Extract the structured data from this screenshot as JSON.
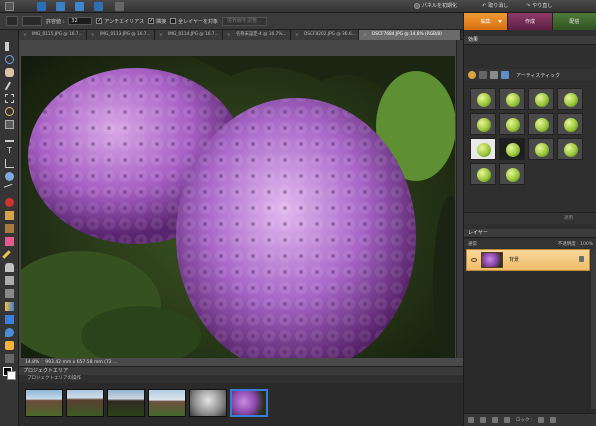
{
  "appbar": {
    "panel_reset": "パネルを初期化",
    "undo": "取り消し",
    "redo": "やり直し"
  },
  "options": {
    "tolerance_label": "許容値 :",
    "tolerance_value": "32",
    "antialias_label": "アンチエイリアス",
    "contiguous_label": "隣接",
    "all_layers_label": "全レイヤーを対象",
    "refine_edge_label": "境界線を調整..."
  },
  "modes": {
    "edit": "編集",
    "create": "作成",
    "share": "配信"
  },
  "doc_tabs": [
    "IMG_0115.JPG @ 16.7...",
    "IMG_0113.JPG @ 16.7...",
    "IMG_0114.JPG @ 16.7...",
    "名称未設定-4 @ 16.7%...",
    "DSCF8202.JPG @ 36.6...",
    "DSCF7684.JPG @ 14.8% (RGB/8)"
  ],
  "status": {
    "zoom": "14.8%",
    "doc_size": "993.42 mm x 657.58 mm (72 ..."
  },
  "project_bin": {
    "title": "プロジェクトエリア",
    "subtitle": "プロジェクトエリアの操作"
  },
  "effects": {
    "title": "効果",
    "category": "アーティスティック",
    "apply": "適用"
  },
  "layers": {
    "title": "レイヤー",
    "mode": "通常",
    "opacity_label": "不透明度 :",
    "opacity_value": "100%",
    "layer_name": "背景",
    "lock_label": "ロック :"
  },
  "colors": {
    "accent_edit": "#e8841f",
    "accent_create": "#7a2d58",
    "accent_share": "#3d6a2d",
    "selection": "#3d7bd8",
    "layer_highlight": "#f5cd82"
  }
}
